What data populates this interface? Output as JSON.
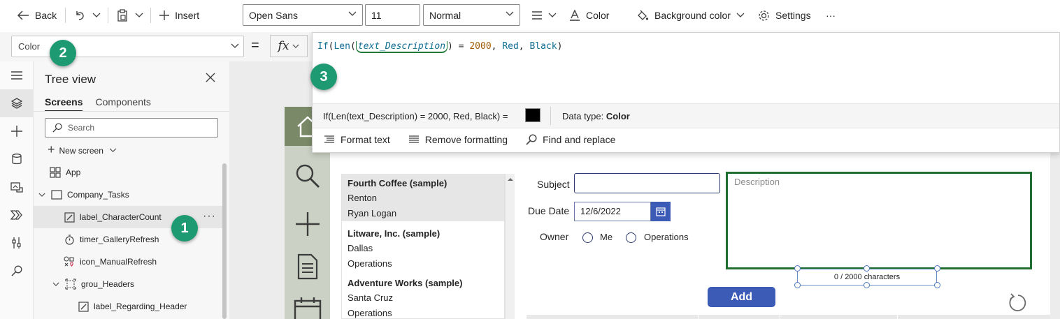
{
  "toolbar": {
    "back": "Back",
    "insert": "Insert",
    "font": "Open Sans",
    "font_size": "11",
    "weight": "Normal",
    "color": "Color",
    "background_color": "Background color",
    "settings": "Settings",
    "more": "···"
  },
  "formula_bar": {
    "property": "Color",
    "equals": "=",
    "fx": "fx",
    "formula_tokens": {
      "fn_if": "If",
      "paren_open": "(",
      "fn_len": "Len",
      "paren_open2": "(",
      "ref": "text_Description",
      "paren_close": ")",
      "eq": " = ",
      "num": "2000",
      "comma1": ", ",
      "red": "Red",
      "comma2": ", ",
      "black": "Black",
      "paren_close2": ")"
    },
    "result_expression": "If(Len(text_Description) = 2000, Red, Black)  =",
    "result_color": "#000000",
    "data_type_label": "Data type:",
    "data_type_value": "Color",
    "tools": [
      "Format text",
      "Remove formatting",
      "Find and replace"
    ]
  },
  "tree": {
    "title": "Tree view",
    "tabs": [
      "Screens",
      "Components"
    ],
    "search_placeholder": "Search",
    "new_screen": "New screen",
    "items": [
      {
        "label": "App"
      },
      {
        "label": "Company_Tasks"
      },
      {
        "label": "label_CharacterCount"
      },
      {
        "label": "timer_GalleryRefresh"
      },
      {
        "label": "icon_ManualRefresh"
      },
      {
        "label": "grou_Headers"
      },
      {
        "label": "label_Regarding_Header"
      }
    ],
    "item_more": "···"
  },
  "gallery": {
    "lines": [
      {
        "text": "Fourth Coffee (sample)",
        "bold": true
      },
      {
        "text": "Renton",
        "bold": false
      },
      {
        "text": "Ryan Logan",
        "bold": false
      },
      {
        "text": "Litware, Inc. (sample)",
        "bold": true
      },
      {
        "text": "Dallas",
        "bold": false
      },
      {
        "text": "Operations",
        "bold": false
      },
      {
        "text": "Adventure Works (sample)",
        "bold": true
      },
      {
        "text": "Santa Cruz",
        "bold": false
      },
      {
        "text": "Operations",
        "bold": false
      }
    ]
  },
  "form": {
    "subject_label": "Subject",
    "due_date_label": "Due Date",
    "due_date_value": "12/6/2022",
    "owner_label": "Owner",
    "owner_options": [
      "Me",
      "Operations"
    ],
    "description_placeholder": "Description",
    "char_count": "0 / 2000 characters",
    "add_button": "Add"
  },
  "callouts": [
    "1",
    "2",
    "3"
  ],
  "colors": {
    "accent_badge": "#1e9a72",
    "button_blue": "#3c5bb6",
    "description_border": "#1f6e2e",
    "nav_green": "#7a8a68"
  }
}
